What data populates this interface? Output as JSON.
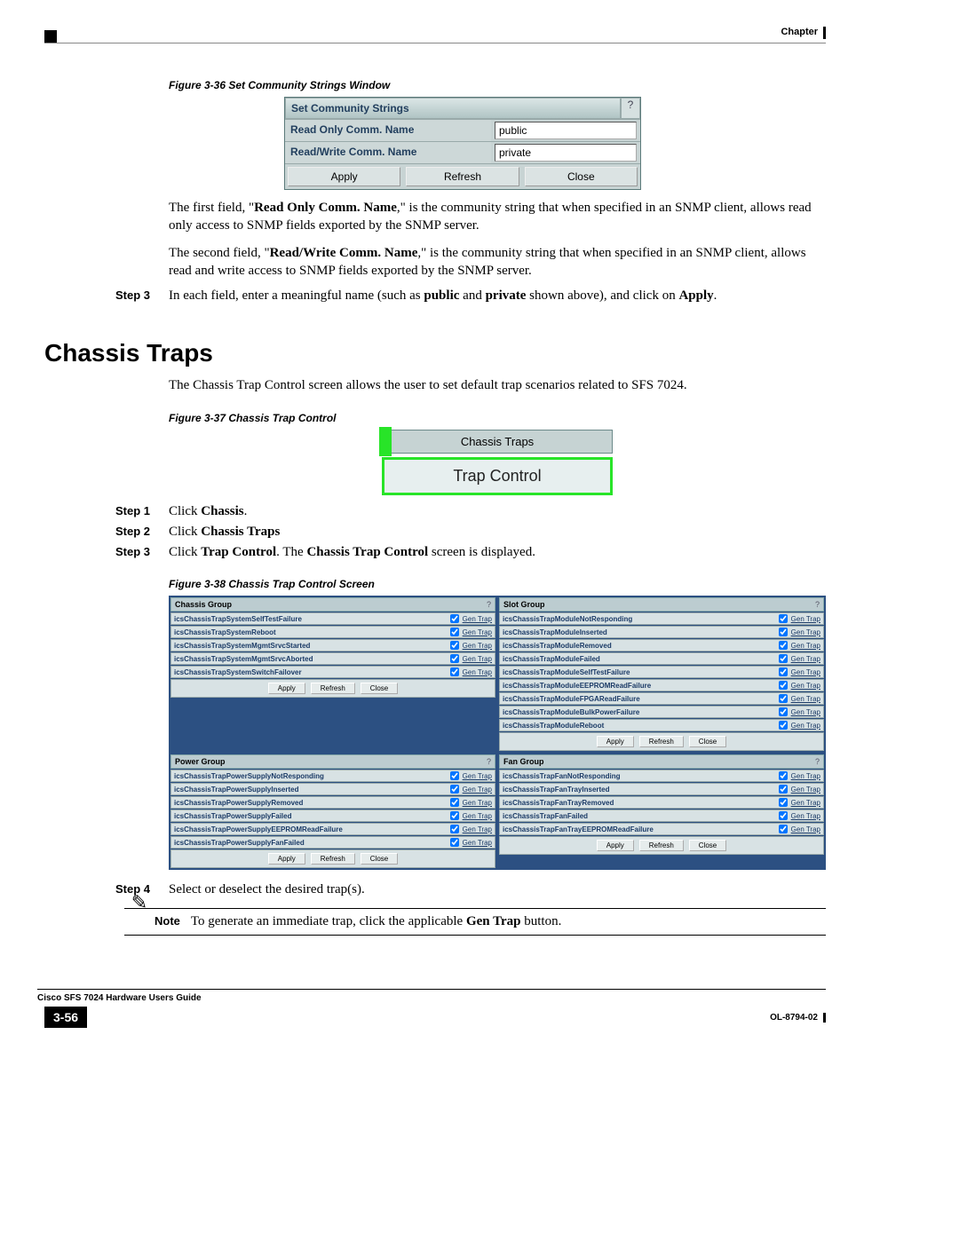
{
  "header": {
    "chapter_label": "Chapter"
  },
  "figures": {
    "fig36_caption": "Figure 3-36   Set Community Strings Window",
    "fig37_caption": "Figure 3-37   Chassis Trap Control",
    "fig38_caption": "Figure 3-38   Chassis Trap Control Screen"
  },
  "comm_window": {
    "title": "Set Community Strings",
    "help": "?",
    "row1_label": "Read Only Comm. Name",
    "row1_value": "public",
    "row2_label": "Read/Write Comm. Name",
    "row2_value": "private",
    "btn_apply": "Apply",
    "btn_refresh": "Refresh",
    "btn_close": "Close"
  },
  "paragraphs": {
    "p1a": "The first field, \"",
    "p1b": "Read Only Comm. Name",
    "p1c": ",\" is the community string that when specified in an SNMP client, allows read only access to SNMP fields exported by the SNMP server.",
    "p2a": "The second field, \"",
    "p2b": "Read/Write Comm. Name",
    "p2c": ",\" is the community string that when specified in an SNMP client, allows read and write access to SNMP fields exported by the SNMP server.",
    "ct_intro": "The Chassis Trap Control screen allows the user to set default trap scenarios related to SFS 7024."
  },
  "steps_top": {
    "s3_label": "Step 3",
    "s3_a": "In each field, enter a meaningful name (such as ",
    "s3_b": "public",
    "s3_c": " and ",
    "s3_d": "private",
    "s3_e": " shown above), and click on ",
    "s3_f": "Apply",
    "s3_g": "."
  },
  "section_heading": "Chassis Traps",
  "tabs": {
    "chassis_traps": "Chassis Traps",
    "trap_control": "Trap Control"
  },
  "steps_ct": {
    "s1_label": "Step 1",
    "s1_a": "Click ",
    "s1_b": "Chassis",
    "s1_c": ".",
    "s2_label": "Step 2",
    "s2_a": "Click ",
    "s2_b": "Chassis Traps",
    "s3_label": "Step 3",
    "s3_a": "Click ",
    "s3_b": "Trap Control",
    "s3_c": ". The ",
    "s3_d": "Chassis Trap Control",
    "s3_e": " screen is displayed.",
    "s4_label": "Step 4",
    "s4_body": "Select or deselect the desired trap(s)."
  },
  "trap_groups": {
    "gen_trap": "Gen Trap",
    "btn_apply": "Apply",
    "btn_refresh": "Refresh",
    "btn_close": "Close",
    "chassis": {
      "title": "Chassis Group",
      "items": [
        "icsChassisTrapSystemSelfTestFailure",
        "icsChassisTrapSystemReboot",
        "icsChassisTrapSystemMgmtSrvcStarted",
        "icsChassisTrapSystemMgmtSrvcAborted",
        "icsChassisTrapSystemSwitchFailover"
      ]
    },
    "slot": {
      "title": "Slot Group",
      "items": [
        "icsChassisTrapModuleNotResponding",
        "icsChassisTrapModuleInserted",
        "icsChassisTrapModuleRemoved",
        "icsChassisTrapModuleFailed",
        "icsChassisTrapModuleSelfTestFailure",
        "icsChassisTrapModuleEEPROMReadFailure",
        "icsChassisTrapModuleFPGAReadFailure",
        "icsChassisTrapModuleBulkPowerFailure",
        "icsChassisTrapModuleReboot"
      ]
    },
    "power": {
      "title": "Power Group",
      "items": [
        "icsChassisTrapPowerSupplyNotResponding",
        "icsChassisTrapPowerSupplyInserted",
        "icsChassisTrapPowerSupplyRemoved",
        "icsChassisTrapPowerSupplyFailed",
        "icsChassisTrapPowerSupplyEEPROMReadFailure",
        "icsChassisTrapPowerSupplyFanFailed"
      ]
    },
    "fan": {
      "title": "Fan Group",
      "items": [
        "icsChassisTrapFanNotResponding",
        "icsChassisTrapFanTrayInserted",
        "icsChassisTrapFanTrayRemoved",
        "icsChassisTrapFanFailed",
        "icsChassisTrapFanTrayEEPROMReadFailure"
      ]
    }
  },
  "note": {
    "label": "Note",
    "a": "To generate an immediate trap, click the applicable ",
    "b": "Gen Trap",
    "c": " button."
  },
  "footer": {
    "book": "Cisco SFS 7024 Hardware Users Guide",
    "page": "3-56",
    "doc": "OL-8794-02"
  }
}
